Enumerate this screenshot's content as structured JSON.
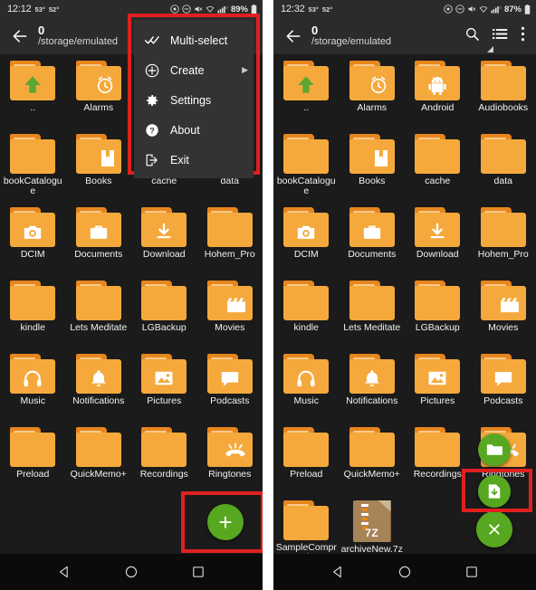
{
  "left": {
    "status": {
      "time": "12:12",
      "temp_high": "53°",
      "temp_low": "52°",
      "battery_pct": "89%",
      "network": "LTE",
      "icons": [
        "location-icon",
        "do-not-disturb-icon",
        "volume-mute-icon",
        "wifi-icon",
        "signal-bars-icon",
        "battery-icon"
      ]
    },
    "toolbar": {
      "title": "0",
      "subtitle": "/storage/emulated",
      "back_icon": "back-arrow-icon"
    },
    "items": [
      {
        "label": "..",
        "glyph": "up-arrow-icon"
      },
      {
        "label": "Alarms",
        "glyph": "alarm-clock-icon"
      },
      {
        "label": "",
        "glyph": "none"
      },
      {
        "label": "",
        "glyph": "none"
      },
      {
        "label": "bookCatalogue",
        "glyph": "none"
      },
      {
        "label": "Books",
        "glyph": "book-icon"
      },
      {
        "label": "cache",
        "glyph": "none"
      },
      {
        "label": "data",
        "glyph": "none"
      },
      {
        "label": "DCIM",
        "glyph": "camera-icon"
      },
      {
        "label": "Documents",
        "glyph": "briefcase-icon"
      },
      {
        "label": "Download",
        "glyph": "download-arrow-icon"
      },
      {
        "label": "Hohem_Pro",
        "glyph": "none"
      },
      {
        "label": "kindle",
        "glyph": "none"
      },
      {
        "label": "Lets Meditate",
        "glyph": "none"
      },
      {
        "label": "LGBackup",
        "glyph": "none"
      },
      {
        "label": "Movies",
        "glyph": "clapperboard-icon"
      },
      {
        "label": "Music",
        "glyph": "headphones-icon"
      },
      {
        "label": "Notifications",
        "glyph": "bell-icon"
      },
      {
        "label": "Pictures",
        "glyph": "image-icon"
      },
      {
        "label": "Podcasts",
        "glyph": "speech-bubble-icon"
      },
      {
        "label": "Preload",
        "glyph": "none"
      },
      {
        "label": "QuickMemo+",
        "glyph": "none"
      },
      {
        "label": "Recordings",
        "glyph": "none"
      },
      {
        "label": "Ringtones",
        "glyph": "ringing-phone-icon"
      }
    ],
    "menu": {
      "items": [
        {
          "label": "Multi-select",
          "icon": "double-check-icon",
          "has_submenu": false
        },
        {
          "label": "Create",
          "icon": "plus-circle-icon",
          "has_submenu": true,
          "arrow": "▶"
        },
        {
          "label": "Settings",
          "icon": "gear-icon",
          "has_submenu": false
        },
        {
          "label": "About",
          "icon": "question-circle-icon",
          "has_submenu": false
        },
        {
          "label": "Exit",
          "icon": "exit-icon",
          "has_submenu": false
        }
      ]
    },
    "fab": {
      "label": "+",
      "name": "add-fab"
    }
  },
  "right": {
    "status": {
      "time": "12:32",
      "temp_high": "53°",
      "temp_low": "52°",
      "battery_pct": "87%",
      "network": "LTE"
    },
    "toolbar": {
      "title": "0",
      "subtitle": "/storage/emulated",
      "back_icon": "back-arrow-icon",
      "actions": [
        "search-icon",
        "list-view-icon",
        "overflow-menu-icon"
      ]
    },
    "items": [
      {
        "label": "..",
        "glyph": "up-arrow-icon"
      },
      {
        "label": "Alarms",
        "glyph": "alarm-clock-icon"
      },
      {
        "label": "Android",
        "glyph": "android-robot-icon"
      },
      {
        "label": "Audiobooks",
        "glyph": "none"
      },
      {
        "label": "bookCatalogue",
        "glyph": "none"
      },
      {
        "label": "Books",
        "glyph": "book-icon"
      },
      {
        "label": "cache",
        "glyph": "none"
      },
      {
        "label": "data",
        "glyph": "none"
      },
      {
        "label": "DCIM",
        "glyph": "camera-icon"
      },
      {
        "label": "Documents",
        "glyph": "briefcase-icon"
      },
      {
        "label": "Download",
        "glyph": "download-arrow-icon"
      },
      {
        "label": "Hohem_Pro",
        "glyph": "none"
      },
      {
        "label": "kindle",
        "glyph": "none"
      },
      {
        "label": "Lets Meditate",
        "glyph": "none"
      },
      {
        "label": "LGBackup",
        "glyph": "none"
      },
      {
        "label": "Movies",
        "glyph": "clapperboard-icon"
      },
      {
        "label": "Music",
        "glyph": "headphones-icon"
      },
      {
        "label": "Notifications",
        "glyph": "bell-icon"
      },
      {
        "label": "Pictures",
        "glyph": "image-icon"
      },
      {
        "label": "Podcasts",
        "glyph": "speech-bubble-icon"
      },
      {
        "label": "Preload",
        "glyph": "none"
      },
      {
        "label": "QuickMemo+",
        "glyph": "none"
      },
      {
        "label": "Recordings",
        "glyph": "none"
      },
      {
        "label": "Ringtones",
        "glyph": "ringing-phone-icon"
      },
      {
        "label": "SampleCompression",
        "glyph": "none"
      },
      {
        "label": "archiveNew.7z",
        "glyph": "archive-7z",
        "ext": "7Z"
      }
    ],
    "fabs": [
      {
        "name": "create-folder-fab",
        "icon": "folder-icon"
      },
      {
        "name": "create-file-fab",
        "icon": "file-download-icon"
      },
      {
        "name": "close-fab",
        "icon": "close-x-icon",
        "label": "✕"
      }
    ]
  },
  "navbar": {
    "back": "nav-back-icon",
    "home": "nav-home-icon",
    "recents": "nav-recents-icon"
  },
  "colors": {
    "folder_body": "#F5A93C",
    "folder_tab": "#E8861E",
    "fab_green": "#57A820",
    "highlight_red": "#E02020",
    "background": "#1B1B1B",
    "toolbar": "#2B2B2B",
    "menu_bg": "#333333"
  }
}
